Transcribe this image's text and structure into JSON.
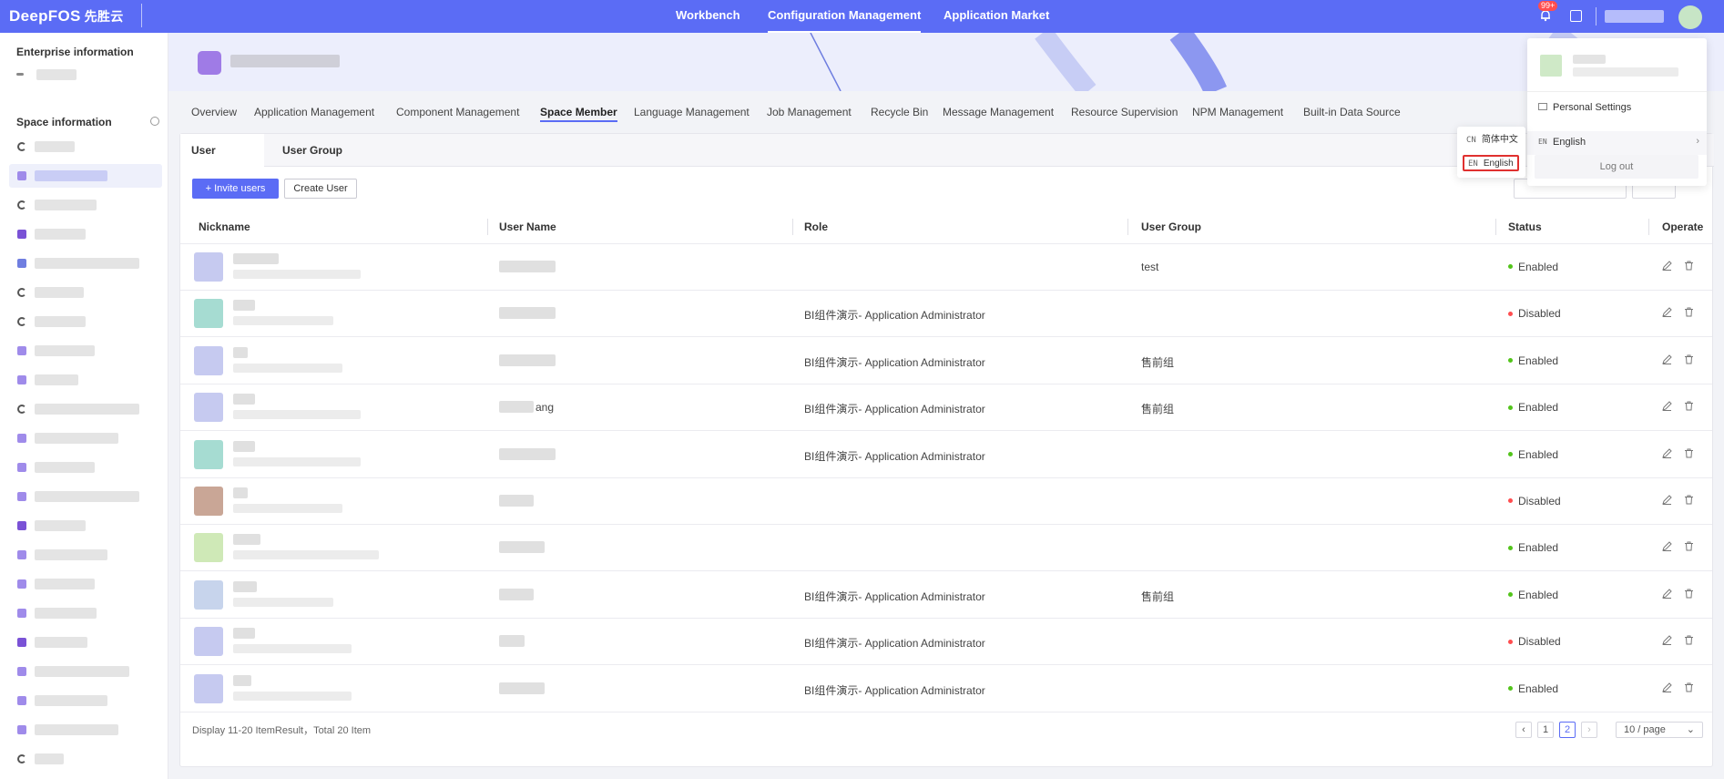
{
  "brand": {
    "logo_text": "DeepFOS",
    "logo_cn": "先胜云"
  },
  "topnav": {
    "tabs": [
      {
        "label": "Workbench"
      },
      {
        "label": "Configuration Management",
        "active": true
      },
      {
        "label": "Application Market"
      }
    ],
    "notification_badge": "99+",
    "accent": "#5b6cf5"
  },
  "sidebar": {
    "enterprise_title": "Enterprise information",
    "space_title": "Space information"
  },
  "subtabs": [
    {
      "label": "Overview"
    },
    {
      "label": "Application Management"
    },
    {
      "label": "Component Management"
    },
    {
      "label": "Space Member",
      "active": true
    },
    {
      "label": "Language Management"
    },
    {
      "label": "Job Management"
    },
    {
      "label": "Recycle Bin"
    },
    {
      "label": "Message Management"
    },
    {
      "label": "Resource Supervision"
    },
    {
      "label": "NPM Management"
    },
    {
      "label": "Built-in Data Source"
    }
  ],
  "card": {
    "tabs": [
      {
        "label": "User",
        "active": true
      },
      {
        "label": "User Group"
      }
    ],
    "invite_label": "+ Invite users",
    "create_label": "Create User"
  },
  "table": {
    "columns": [
      "Nickname",
      "User Name",
      "Role",
      "User Group",
      "Status",
      "Operate"
    ],
    "rows": [
      {
        "username_suffix": "",
        "role": "",
        "group": "test",
        "status": "Enabled"
      },
      {
        "username_suffix": "",
        "role": "BI组件演示- Application Administrator",
        "group": "",
        "status": "Disabled"
      },
      {
        "username_suffix": "",
        "role": "BI组件演示- Application Administrator",
        "group": "售前组",
        "status": "Enabled"
      },
      {
        "username_suffix": "ang",
        "role": "BI组件演示- Application Administrator",
        "group": "售前组",
        "status": "Enabled"
      },
      {
        "username_suffix": "",
        "role": "BI组件演示- Application Administrator",
        "group": "",
        "status": "Enabled"
      },
      {
        "username_suffix": "",
        "role": "",
        "group": "",
        "status": "Disabled"
      },
      {
        "username_suffix": "",
        "role": "",
        "group": "",
        "status": "Enabled"
      },
      {
        "username_suffix": "",
        "role": "BI组件演示- Application Administrator",
        "group": "售前组",
        "status": "Enabled"
      },
      {
        "username_suffix": "",
        "role": "BI组件演示- Application Administrator",
        "group": "",
        "status": "Disabled"
      },
      {
        "username_suffix": "",
        "role": "BI组件演示- Application Administrator",
        "group": "",
        "status": "Enabled"
      }
    ]
  },
  "footer": {
    "summary": "Display 11-20 ItemResult，Total 20 Item",
    "pages": [
      "1",
      "2"
    ],
    "page_size": "10 / page"
  },
  "user_menu": {
    "personal_settings": "Personal Settings",
    "language_code": "EN",
    "language_label": "English",
    "logout": "Log out"
  },
  "lang_menu": {
    "items": [
      {
        "code": "CN",
        "label": "简体中文"
      },
      {
        "code": "EN",
        "label": "English"
      }
    ]
  },
  "colors": {
    "enabled": "#52c41a",
    "disabled": "#ff4d4f"
  }
}
